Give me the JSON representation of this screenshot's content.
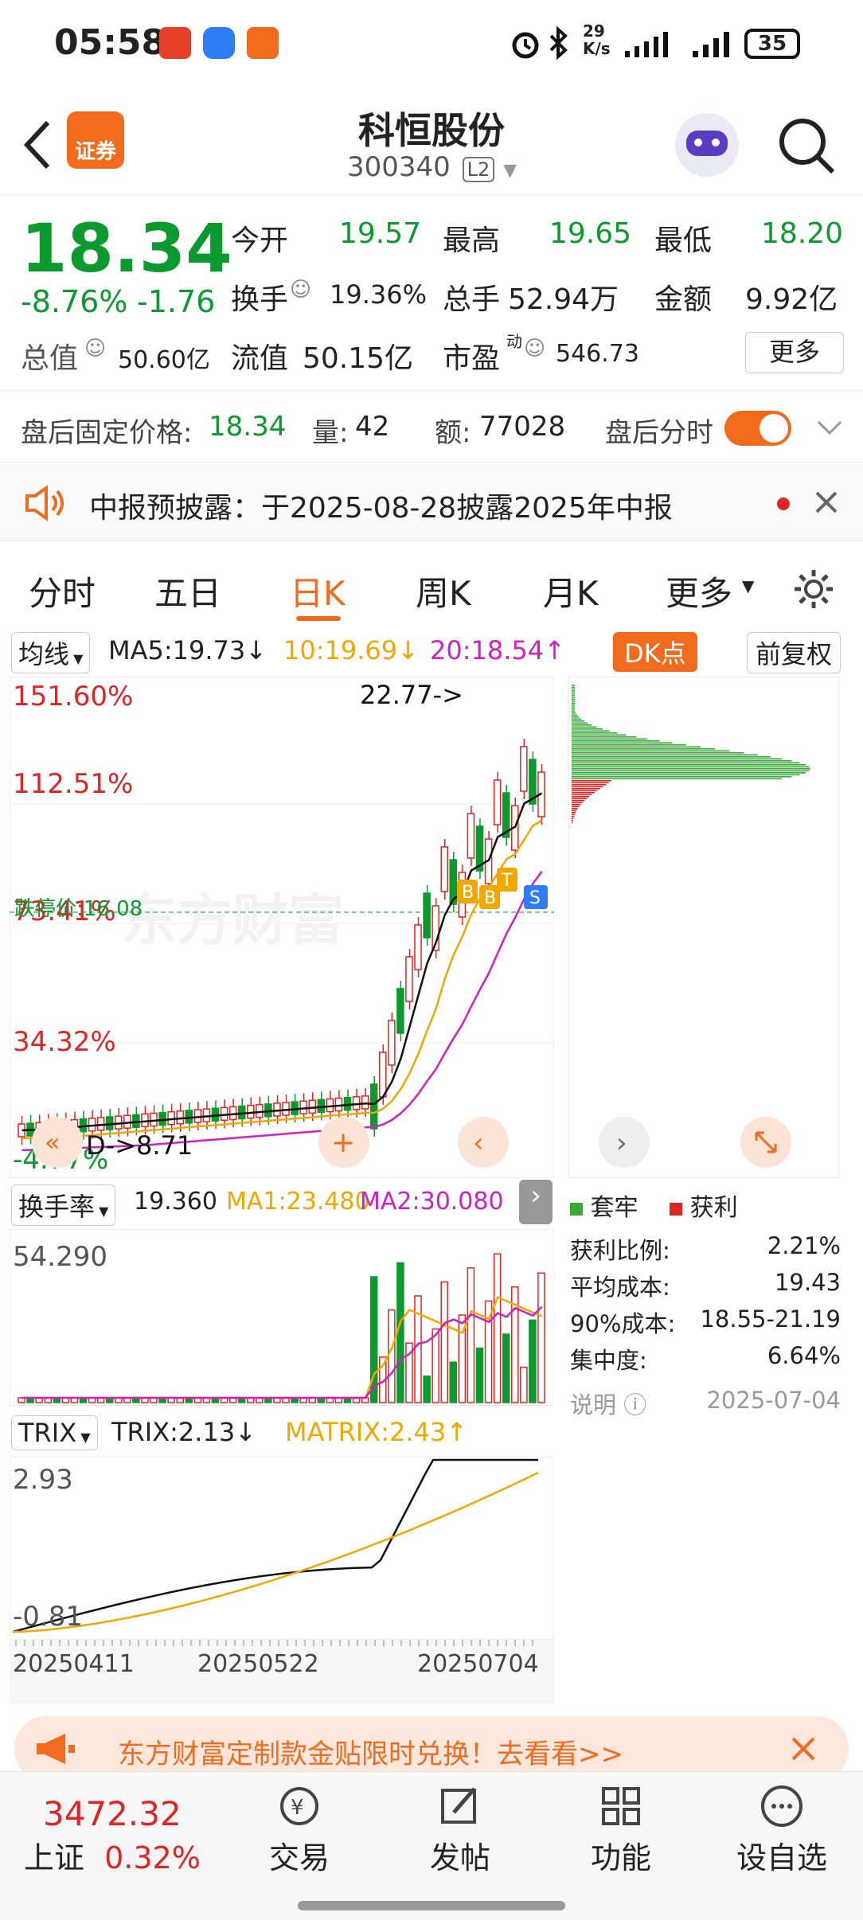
{
  "status": {
    "time": "05:58",
    "net_speed": "29\nK/s",
    "battery": "35",
    "app_icons": [
      "dongfang-icon",
      "message-icon",
      "securities-icon"
    ]
  },
  "header": {
    "stock_name": "科恒股份",
    "stock_code": "300340",
    "level_badge": "L2"
  },
  "quote": {
    "price": "18.34",
    "change_pct": "-8.76%",
    "change_abs": "-1.76",
    "open_label": "今开",
    "open": "19.57",
    "high_label": "最高",
    "high": "19.65",
    "low_label": "最低",
    "low": "18.20",
    "turnover_label": "换手",
    "turnover": "19.36%",
    "volume_label": "总手",
    "volume": "52.94万",
    "amount_label": "金额",
    "amount": "9.92亿",
    "mcap_label": "总值",
    "mcap": "50.60亿",
    "float_label": "流值",
    "float": "50.15亿",
    "pe_label": "市盈",
    "pe_sup": "动",
    "pe": "546.73",
    "more_button": "更多"
  },
  "after_hours": {
    "fixed_label": "盘后固定价格:",
    "fixed_price": "18.34",
    "vol_label": "量:",
    "vol": "42",
    "amt_label": "额:",
    "amt": "77028",
    "timeshare_label": "盘后分时"
  },
  "notice": {
    "text": "中报预披露：于2025-08-28披露2025年中报"
  },
  "tabs": [
    "分时",
    "五日",
    "日K",
    "周K",
    "月K",
    "更多"
  ],
  "kchart": {
    "ma_selector": "均线",
    "ma5": "MA5:19.73",
    "ma10": "10:19.69",
    "ma20": "20:18.54",
    "ma5_arrow": "↓",
    "ma10_arrow": "↓",
    "ma20_arrow": "↑",
    "dk_button": "DK点",
    "adjust_button": "前复权",
    "pct_labels": [
      "151.60%",
      "112.51%",
      "73.41%",
      "34.32%",
      "-4.77%"
    ],
    "high_marker": "22.77->",
    "low_marker": "D->8.71",
    "limit_label": "跌停价:16.08",
    "watermark": "东方财富"
  },
  "chips": {
    "legend_trapped": "套牢",
    "legend_profit": "获利",
    "rows": [
      [
        "获利比例:",
        "2.21%"
      ],
      [
        "平均成本:",
        "19.43"
      ],
      [
        "90%成本:",
        "18.55-21.19"
      ],
      [
        "集中度:",
        "6.64%"
      ]
    ],
    "note_label": "说明",
    "date": "2025-07-04"
  },
  "turnover_chart": {
    "selector": "换手率",
    "value": "19.360",
    "ma1": "MA1:23.480",
    "ma2": "MA2:30.080",
    "max_label": "54.290"
  },
  "trix_chart": {
    "selector": "TRIX",
    "trix": "TRIX:2.13",
    "matrix": "MATRIX:2.43",
    "max_label": "2.93",
    "min_label": "-0.81",
    "dates": [
      "20250411",
      "20250522",
      "20250704"
    ]
  },
  "banner": {
    "text": "东方财富定制款金贴限时兑换！去看看>>"
  },
  "bottom": {
    "index_value": "3472.32",
    "index_name": "上证",
    "index_change": "0.32%",
    "items": [
      "交易",
      "发帖",
      "功能",
      "设自选"
    ]
  },
  "colors": {
    "up": "#e02424",
    "down": "#0a9a2e",
    "accent": "#f26b1d",
    "ma10": "#f0a800",
    "ma20": "#d21fc0"
  }
}
